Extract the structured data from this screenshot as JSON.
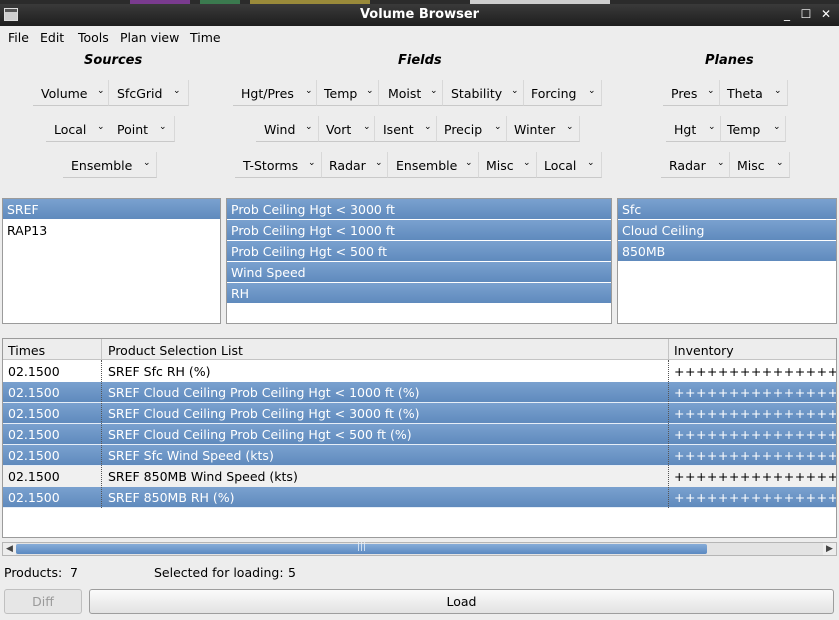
{
  "window": {
    "title": "Volume Browser",
    "controls": [
      "_",
      "☐",
      "✕"
    ]
  },
  "menu": [
    "File",
    "Edit",
    "Tools",
    "Plan view",
    "Time"
  ],
  "sections": {
    "sources": "Sources",
    "fields": "Fields",
    "planes": "Planes"
  },
  "dropdowns": {
    "sources": [
      [
        "Volume",
        "SfcGrid"
      ],
      [
        "Local",
        "Point"
      ],
      [
        "Ensemble"
      ]
    ],
    "fields": [
      [
        "Hgt/Pres",
        "Temp",
        "Moist",
        "Stability",
        "Forcing"
      ],
      [
        "Wind",
        "Vort",
        "Isent",
        "Precip",
        "Winter"
      ],
      [
        "T-Storms",
        "Radar",
        "Ensemble",
        "Misc",
        "Local"
      ]
    ],
    "planes": [
      [
        "Pres",
        "Theta"
      ],
      [
        "Hgt",
        "Temp"
      ],
      [
        "Radar",
        "Misc"
      ]
    ]
  },
  "sources_list": [
    {
      "label": "SREF",
      "selected": true
    },
    {
      "label": "RAP13",
      "selected": false
    }
  ],
  "fields_list": [
    {
      "label": "Prob Ceiling Hgt < 3000 ft",
      "selected": true
    },
    {
      "label": "Prob Ceiling Hgt < 1000 ft",
      "selected": true
    },
    {
      "label": "Prob Ceiling Hgt < 500 ft",
      "selected": true
    },
    {
      "label": "Wind Speed",
      "selected": true
    },
    {
      "label": "RH",
      "selected": true
    }
  ],
  "planes_list": [
    {
      "label": "Sfc",
      "selected": true
    },
    {
      "label": "Cloud Ceiling",
      "selected": true
    },
    {
      "label": "850MB",
      "selected": true
    }
  ],
  "table": {
    "columns": [
      "Times",
      "Product Selection List",
      "Inventory"
    ],
    "rows": [
      {
        "time": "02.1500",
        "product": "SREF Sfc RH (%)",
        "inventory": "++++++++++++++++++++",
        "selected": false
      },
      {
        "time": "02.1500",
        "product": "SREF Cloud Ceiling Prob Ceiling Hgt < 1000 ft (%)",
        "inventory": "++++++++++++++++++++",
        "selected": true
      },
      {
        "time": "02.1500",
        "product": "SREF Cloud Ceiling Prob Ceiling Hgt < 3000 ft (%)",
        "inventory": "++++++++++++++++++++",
        "selected": true
      },
      {
        "time": "02.1500",
        "product": "SREF Cloud Ceiling Prob Ceiling Hgt < 500 ft (%)",
        "inventory": "++++++++++++++++++++",
        "selected": true
      },
      {
        "time": "02.1500",
        "product": "SREF Sfc Wind Speed (kts)",
        "inventory": "++++++++++++++++++++",
        "selected": true
      },
      {
        "time": "02.1500",
        "product": "SREF 850MB Wind Speed (kts)",
        "inventory": "++++++++++++++++++++",
        "selected": false
      },
      {
        "time": "02.1500",
        "product": "SREF 850MB RH (%)",
        "inventory": "++++++++++++++++++++",
        "selected": true
      }
    ]
  },
  "status": {
    "products_label": "Products:",
    "products_count": "7",
    "selected_label": "Selected for loading:",
    "selected_count": "5"
  },
  "buttons": {
    "diff": "Diff",
    "load": "Load"
  },
  "colors": {
    "selection": "#6b94c4",
    "titlebar": "#2a2a2a"
  }
}
